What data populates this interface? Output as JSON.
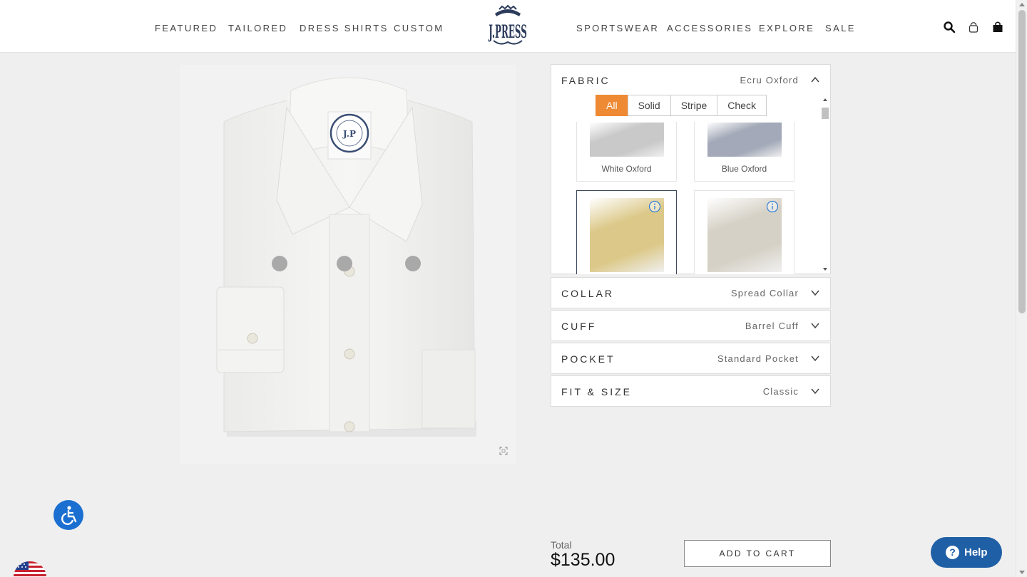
{
  "header": {
    "nav_left": [
      "FEATURED",
      "TAILORED",
      "DRESS SHIRTS",
      "CUSTOM"
    ],
    "nav_right": [
      "SPORTSWEAR",
      "ACCESSORIES",
      "EXPLORE",
      "SALE"
    ],
    "logo_text": "J.PRESS",
    "icons": [
      "search-icon",
      "account-icon",
      "cart-icon"
    ]
  },
  "configurator": {
    "fabric": {
      "title": "FABRIC",
      "value": "Ecru Oxford",
      "expanded": true,
      "filters": [
        "All",
        "Solid",
        "Stripe",
        "Check"
      ],
      "active_filter": "All",
      "swatches": [
        {
          "name": "White Oxford",
          "color": "#c9c9c9"
        },
        {
          "name": "Blue Oxford",
          "color": "#a3a9b8"
        },
        {
          "name": "",
          "color": "#dcc98a",
          "selected": true
        },
        {
          "name": "",
          "color": "#d6d1c6"
        }
      ]
    },
    "collar": {
      "title": "COLLAR",
      "value": "Spread Collar"
    },
    "cuff": {
      "title": "CUFF",
      "value": "Barrel Cuff"
    },
    "pocket": {
      "title": "POCKET",
      "value": "Standard Pocket"
    },
    "fit": {
      "title": "FIT & SIZE",
      "value": "Classic"
    }
  },
  "total": {
    "label": "Total",
    "value": "$135.00"
  },
  "cart_button": "ADD TO CART",
  "help_button": "Help",
  "colors": {
    "accent": "#ee8a33",
    "help": "#1f5fa6",
    "accessibility": "#1b6fd1",
    "selected_border": "#3c4a5c"
  }
}
